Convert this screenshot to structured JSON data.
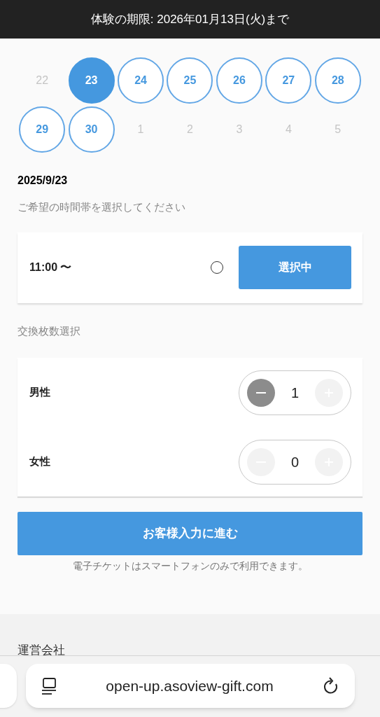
{
  "banner": {
    "text": "体験の期限: 2026年01月13日(火)まで"
  },
  "calendar": {
    "days": [
      {
        "label": "22",
        "available": false,
        "selected": false
      },
      {
        "label": "23",
        "available": true,
        "selected": true
      },
      {
        "label": "24",
        "available": true,
        "selected": false
      },
      {
        "label": "25",
        "available": true,
        "selected": false
      },
      {
        "label": "26",
        "available": true,
        "selected": false
      },
      {
        "label": "27",
        "available": true,
        "selected": false
      },
      {
        "label": "28",
        "available": true,
        "selected": false
      },
      {
        "label": "29",
        "available": true,
        "selected": false
      },
      {
        "label": "30",
        "available": true,
        "selected": false
      },
      {
        "label": "1",
        "available": false,
        "selected": false
      },
      {
        "label": "2",
        "available": false,
        "selected": false
      },
      {
        "label": "3",
        "available": false,
        "selected": false
      },
      {
        "label": "4",
        "available": false,
        "selected": false
      },
      {
        "label": "5",
        "available": false,
        "selected": false
      }
    ]
  },
  "selected_date": "2025/9/23",
  "time_prompt": "ご希望の時間帯を選択してください",
  "time_slots": [
    {
      "time": "11:00 〜",
      "checked": false,
      "button": "選択中",
      "selected": true
    }
  ],
  "quantity_label": "交換枚数選択",
  "quantities": [
    {
      "label": "男性",
      "value": "1",
      "minus_enabled": true,
      "plus_enabled": false
    },
    {
      "label": "女性",
      "value": "0",
      "minus_enabled": false,
      "plus_enabled": false
    }
  ],
  "proceed_button": "お客様入力に進む",
  "note": "電子チケットはスマートフォンのみで利用できます。",
  "footer": {
    "heading": "運営会社"
  },
  "browser": {
    "url": "open-up.asoview-gift.com"
  }
}
